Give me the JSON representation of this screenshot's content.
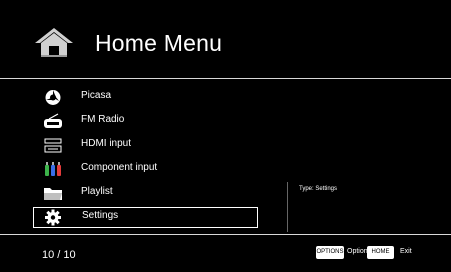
{
  "header": {
    "title": "Home Menu",
    "icon": "home-icon"
  },
  "menu": {
    "items": [
      {
        "label": "Picasa",
        "icon": "picasa-icon"
      },
      {
        "label": "FM Radio",
        "icon": "radio-icon"
      },
      {
        "label": "HDMI input",
        "icon": "hdmi-icon"
      },
      {
        "label": "Component input",
        "icon": "component-icon"
      },
      {
        "label": "Playlist",
        "icon": "folder-icon"
      },
      {
        "label": "Settings",
        "icon": "gear-icon",
        "selected": true
      }
    ]
  },
  "info": {
    "type_text": "Type: Settings"
  },
  "footer": {
    "count": "10 / 10",
    "options_key": "OPTIONS",
    "options_label": "Option",
    "home_key": "HOME",
    "home_label": "Exit"
  },
  "colors": {
    "background": "#000000",
    "text": "#ffffff",
    "key_bg": "#ffffff"
  }
}
